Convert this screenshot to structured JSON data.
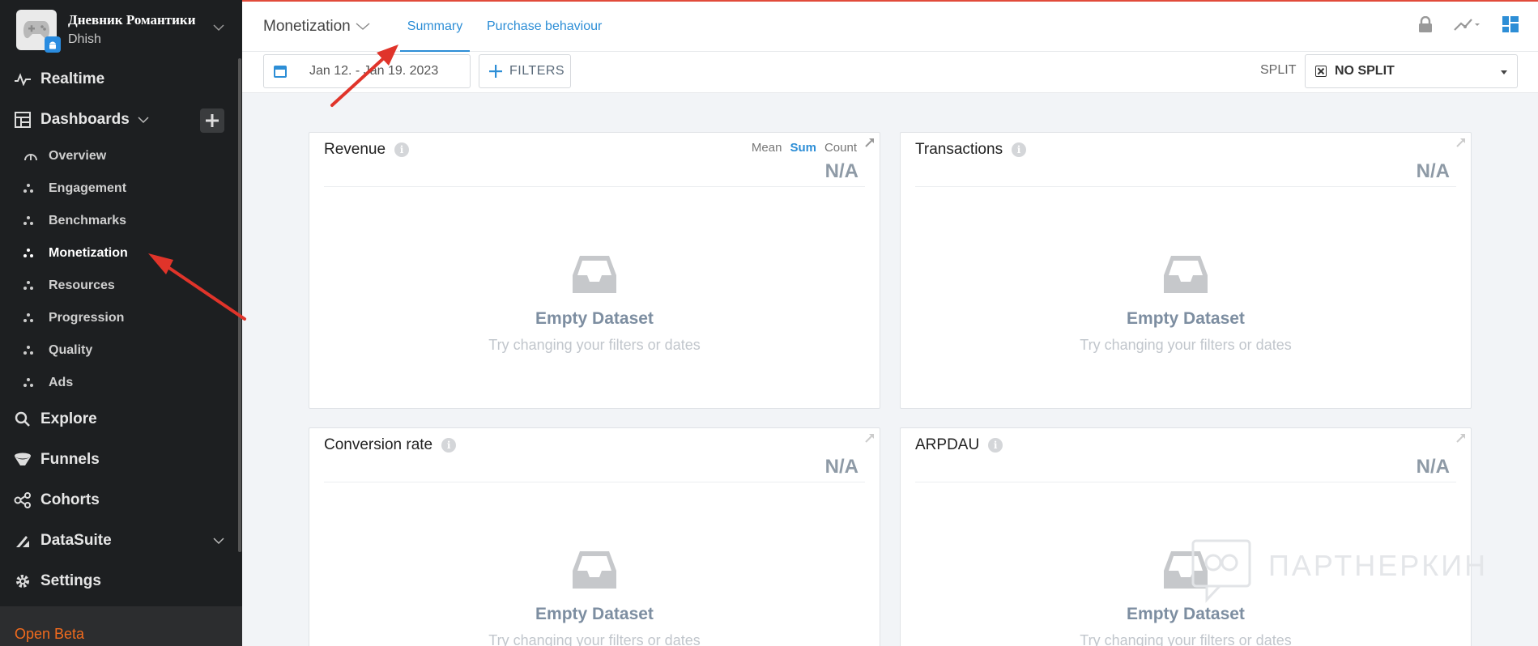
{
  "app": {
    "name": "Дневник Романтики",
    "subtitle": "Dhish"
  },
  "sidebar": {
    "realtime": "Realtime",
    "dashboards": "Dashboards",
    "dashboard_items": [
      {
        "label": "Overview"
      },
      {
        "label": "Engagement"
      },
      {
        "label": "Benchmarks"
      },
      {
        "label": "Monetization",
        "active": true
      },
      {
        "label": "Resources"
      },
      {
        "label": "Progression"
      },
      {
        "label": "Quality"
      },
      {
        "label": "Ads"
      }
    ],
    "explore": "Explore",
    "funnels": "Funnels",
    "cohorts": "Cohorts",
    "datasuite": "DataSuite",
    "settings": "Settings",
    "open_beta": "Open Beta"
  },
  "header": {
    "breadcrumb": "Monetization",
    "tabs": [
      {
        "label": "Summary",
        "active": true
      },
      {
        "label": "Purchase behaviour"
      }
    ]
  },
  "toolbar": {
    "date_range": "Jan 12. - Jan 19. 2023",
    "filters_label": "FILTERS",
    "split_label": "SPLIT",
    "split_value": "NO SPLIT"
  },
  "cards": [
    {
      "title": "Revenue",
      "metric_tabs": [
        "Mean",
        "Sum",
        "Count"
      ],
      "value": "N/A",
      "empty_title": "Empty Dataset",
      "empty_sub": "Try changing your filters or dates"
    },
    {
      "title": "Transactions",
      "value": "N/A",
      "empty_title": "Empty Dataset",
      "empty_sub": "Try changing your filters or dates"
    },
    {
      "title": "Conversion rate",
      "value": "N/A",
      "empty_title": "Empty Dataset",
      "empty_sub": "Try changing your filters or dates"
    },
    {
      "title": "ARPDAU",
      "value": "N/A",
      "empty_title": "Empty Dataset",
      "empty_sub": "Try changing your filters or dates"
    }
  ],
  "watermark": "ПАРТНЕРКИН",
  "colors": {
    "sidebar_bg": "#1d1f21",
    "accent_blue": "#2d8ed6",
    "annotation_red": "#e0342a",
    "open_beta_orange": "#f26b1d"
  }
}
